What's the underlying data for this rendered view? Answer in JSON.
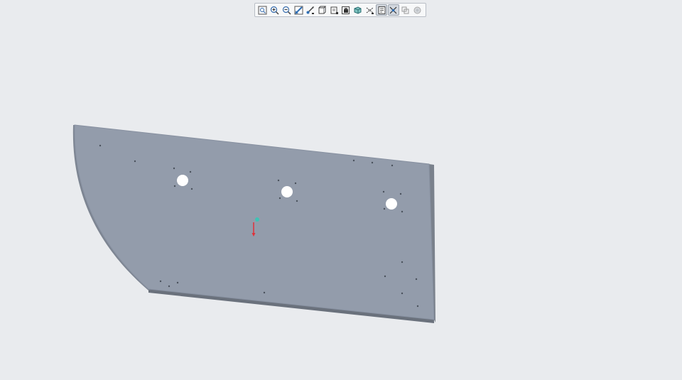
{
  "viewport": {
    "background": "#e9ebee"
  },
  "toolbar": {
    "buttons": [
      {
        "icon": "zoom-fit-icon",
        "active": false
      },
      {
        "icon": "zoom-in-icon",
        "active": false
      },
      {
        "icon": "zoom-out-icon",
        "active": false
      },
      {
        "icon": "repaint-icon",
        "active": false
      },
      {
        "icon": "view-orient-icon",
        "active": false
      },
      {
        "icon": "saved-views-icon",
        "active": false
      },
      {
        "icon": "display-style-icon",
        "active": false
      },
      {
        "icon": "section-view-icon",
        "active": false
      },
      {
        "icon": "perspective-icon",
        "active": false
      },
      {
        "icon": "datum-display-icon",
        "active": false
      },
      {
        "icon": "annotation-display-icon",
        "active": true
      },
      {
        "icon": "spin-center-icon",
        "active": true
      },
      {
        "icon": "layers-icon",
        "active": false
      },
      {
        "icon": "appearance-icon",
        "active": false
      }
    ]
  },
  "model": {
    "face_color": "#939cab",
    "edge_color": "#5f6672",
    "hole_color": "#ffffff"
  },
  "csys": {
    "x_axis_color": "#e0313a",
    "origin_color": "#3fc2b4"
  }
}
